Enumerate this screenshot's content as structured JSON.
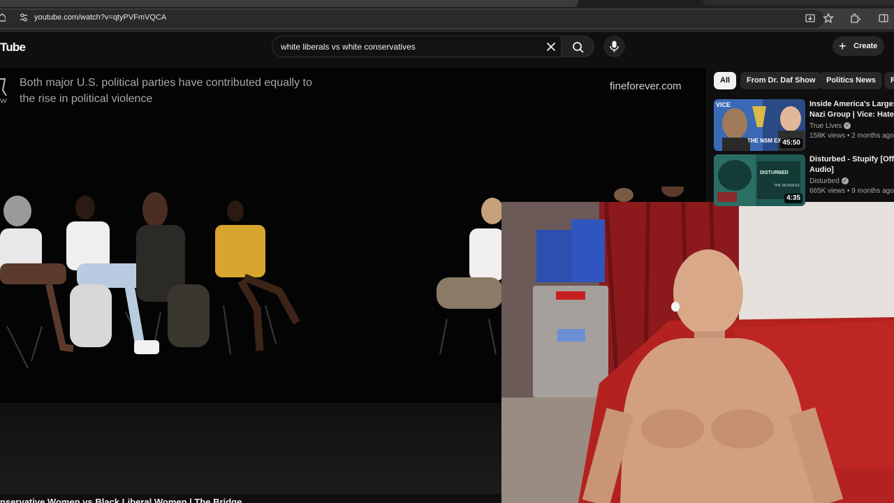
{
  "browser": {
    "url": "youtube.com/watch?v=qtyPVFmVQCA",
    "icons": [
      "home-icon",
      "site-info-icon",
      "install-app-icon",
      "bookmark-star-icon",
      "extensions-icon",
      "side-panel-icon"
    ]
  },
  "header": {
    "logo_text": "Tube",
    "search_query": "white liberals vs white conservatives",
    "create_label": "Create",
    "icons": [
      "clear-icon",
      "search-icon",
      "mic-icon",
      "plus-icon"
    ]
  },
  "player": {
    "caption": "Both major U.S. political parties have contributed equally to the rise in political violence",
    "watermark": "fineforever.com"
  },
  "video": {
    "title_partial": "nservative Women vs Black Liberal Women | The Bridge"
  },
  "sidebar": {
    "chips": [
      "All",
      "From Dr. Daf Show",
      "Politics News",
      "R"
    ],
    "active_chip": "All",
    "recommendations": [
      {
        "title_line1": "Inside America's Largest",
        "title_line2": "Nazi Group | Vice: Hate T",
        "channel": "True Lives",
        "verified": true,
        "stats": "158K views • 2 months ago",
        "duration": "45:50",
        "thumb_text_top": "VICE",
        "thumb_text_bottom": "THE NSM EXPO"
      },
      {
        "title_line1": "Disturbed - Stupify [Offici",
        "title_line2": "Audio]",
        "channel": "Disturbed",
        "verified": true,
        "stats": "665K views • 9 months ago",
        "duration": "4:35",
        "thumb_text_top": "DISTURBED",
        "thumb_text_bottom": "THE SICKNESS"
      }
    ]
  },
  "colors": {
    "page_bg": "#0f0f0f",
    "chip_active_bg": "#f1f1f1",
    "chip_bg": "#272727",
    "browser_bar": "#3c3c3c"
  }
}
